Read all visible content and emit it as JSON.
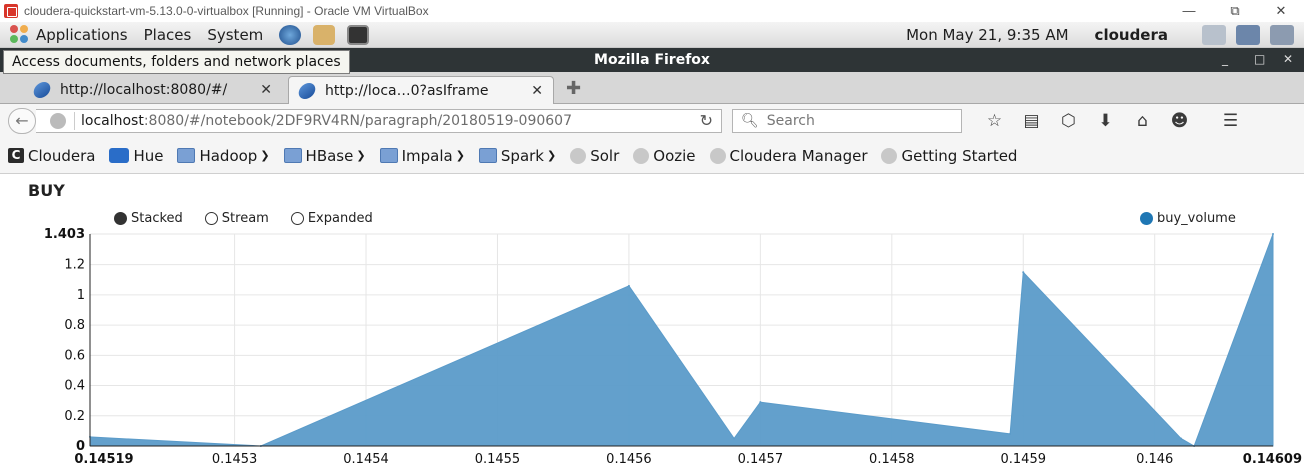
{
  "vm_window": {
    "title": "cloudera-quickstart-vm-5.13.0-0-virtualbox [Running] - Oracle VM VirtualBox",
    "minimize": "—",
    "restore": "⧉",
    "close": "✕"
  },
  "panel": {
    "applications": "Applications",
    "places": "Places",
    "system": "System",
    "clock": "Mon May 21,  9:35 AM",
    "user": "cloudera"
  },
  "tooltip": "Access documents, folders and network places",
  "firefox": {
    "title": "Mozilla Firefox",
    "tabs": [
      {
        "label": "http://localhost:8080/#/"
      },
      {
        "label": "http://loca…0?asIframe"
      }
    ],
    "url_host": "localhost",
    "url_rest": ":8080/#/notebook/2DF9RV4RN/paragraph/20180519-090607",
    "search_placeholder": "Search",
    "bookmarks": [
      {
        "label": "Cloudera",
        "icon": "cloudera-icon"
      },
      {
        "label": "Hue",
        "icon": "hue-icon"
      },
      {
        "label": "Hadoop",
        "icon": "folder-icon"
      },
      {
        "label": "HBase",
        "icon": "folder-icon"
      },
      {
        "label": "Impala",
        "icon": "folder-icon"
      },
      {
        "label": "Spark",
        "icon": "folder-icon"
      },
      {
        "label": "Solr",
        "icon": "bookmark-icon"
      },
      {
        "label": "Oozie",
        "icon": "bookmark-icon"
      },
      {
        "label": "Cloudera Manager",
        "icon": "bookmark-icon"
      },
      {
        "label": "Getting Started",
        "icon": "bookmark-icon"
      }
    ]
  },
  "page": {
    "title": "BUY",
    "controls": {
      "stacked": "Stacked",
      "stream": "Stream",
      "expanded": "Expanded"
    }
  },
  "chart_data": {
    "type": "area",
    "series": [
      {
        "name": "buy_volume",
        "color": "#5b9bc9",
        "x": [
          0.14519,
          0.14532,
          0.1456,
          0.14568,
          0.1457,
          0.14589,
          0.1459,
          0.14602,
          0.14603,
          0.14609
        ],
        "y": [
          0.06,
          0.0,
          1.06,
          0.05,
          0.29,
          0.08,
          1.15,
          0.05,
          0.0,
          1.403
        ]
      }
    ],
    "xlim": [
      0.14519,
      0.14609
    ],
    "ylim": [
      0,
      1.403
    ],
    "x_ticks": [
      "0.14519",
      "0.1453",
      "0.1454",
      "0.1455",
      "0.1456",
      "0.1457",
      "0.1458",
      "0.1459",
      "0.146",
      "0.14609"
    ],
    "x_tick_values": [
      0.14519,
      0.1453,
      0.1454,
      0.1455,
      0.1456,
      0.1457,
      0.1458,
      0.1459,
      0.146,
      0.14609
    ],
    "y_ticks": [
      "0",
      "0.2",
      "0.4",
      "0.6",
      "0.8",
      "1",
      "1.2",
      "1.403"
    ],
    "y_tick_values": [
      0,
      0.2,
      0.4,
      0.6,
      0.8,
      1.0,
      1.2,
      1.403
    ],
    "grid": true,
    "legend": "top-right"
  }
}
